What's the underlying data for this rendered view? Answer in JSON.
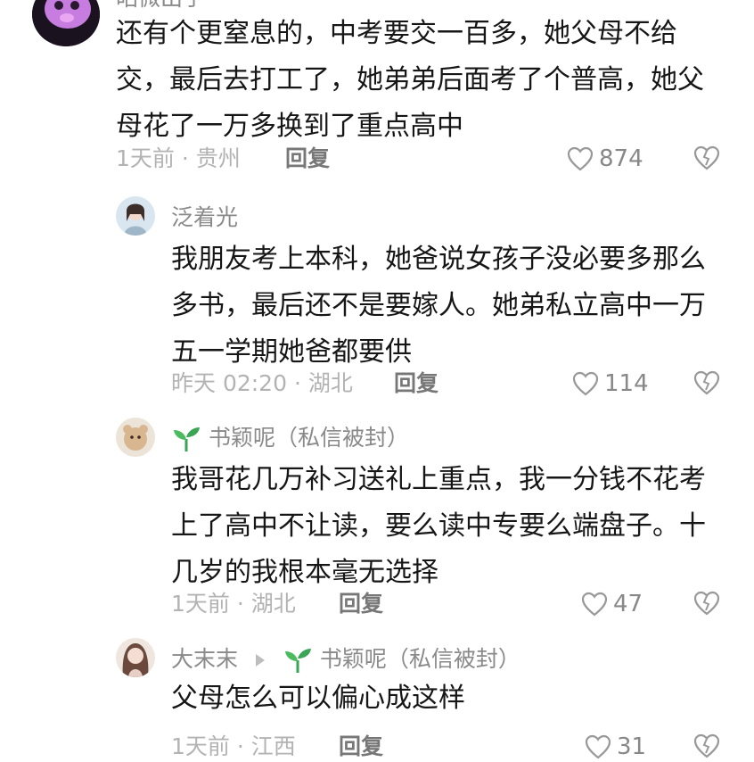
{
  "comments": [
    {
      "user": "昭微出手",
      "text": "还有个更窒息的，中考要交一百多，她父母不给交，最后去打工了，她弟弟后面考了个普高，她父母花了一万多换到了重点高中",
      "time_location": "1天前 · 贵州",
      "reply_label": "回复",
      "likes": "874"
    },
    {
      "user": "泛着光",
      "text": "我朋友考上本科，她爸说女孩子没必要多那么多书，最后还不是要嫁人。她弟私立高中一万五一学期她爸都要供",
      "time_location": "昨天 02:20 · 湖北",
      "reply_label": "回复",
      "likes": "114"
    },
    {
      "user": "书颖呢（私信被封）",
      "text": "我哥花几万补习送礼上重点，我一分钱不花考上了高中不让读，要么读中专要么端盘子。十几岁的我根本毫无选择",
      "time_location": "1天前 · 湖北",
      "reply_label": "回复",
      "likes": "47"
    },
    {
      "user": "大末末",
      "reply_to": "书颖呢（私信被封）",
      "text": "父母怎么可以偏心成这样",
      "time_location": "1天前 · 江西",
      "reply_label": "回复",
      "likes": "31"
    }
  ],
  "icons": {
    "like": "heart-outline-icon",
    "dislike": "broken-heart-icon",
    "sprout": "sprout-icon",
    "reply_arrow": "triangle-right-icon"
  }
}
